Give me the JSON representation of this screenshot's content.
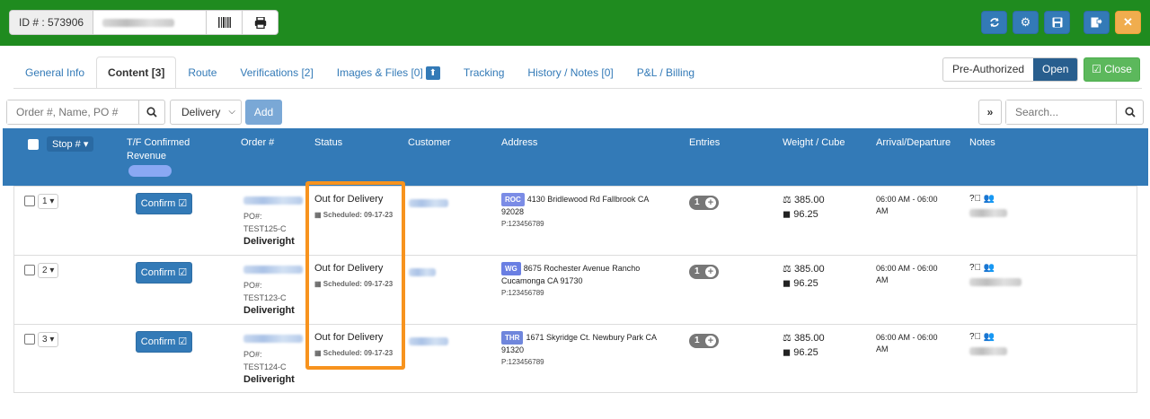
{
  "topbar": {
    "id_label": "ID # : 573906",
    "barcode_icon": "barcode-icon",
    "print_icon": "print-icon",
    "buttons": [
      "refresh-icon",
      "gear-icon",
      "save-icon",
      "save-exit-icon",
      "close-icon"
    ],
    "close_symbol": "✕"
  },
  "tabs": [
    {
      "label": "General Info"
    },
    {
      "label": "Content [3]"
    },
    {
      "label": "Route"
    },
    {
      "label": "Verifications [2]"
    },
    {
      "label": "Images & Files [0]"
    },
    {
      "label": "Tracking"
    },
    {
      "label": "History / Notes [0]"
    },
    {
      "label": "P&L / Billing"
    }
  ],
  "status_toggle": {
    "preauth": "Pre-Authorized",
    "open": "Open"
  },
  "close_btn": "Close",
  "search": {
    "placeholder": "Order #, Name, PO #",
    "delivery": "Delivery",
    "add": "Add",
    "right_placeholder": "Search..."
  },
  "table": {
    "headers": {
      "stop": "Stop #",
      "tf1": "T/F Confirmed",
      "tf2": "Revenue",
      "order": "Order #",
      "status": "Status",
      "customer": "Customer",
      "address": "Address",
      "entries": "Entries",
      "weight": "Weight / Cube",
      "arrival": "Arrival/Departure",
      "notes": "Notes"
    },
    "rows": [
      {
        "stop": "1",
        "confirm": "Confirm",
        "po": "PO#:",
        "po_value": "TEST125-C",
        "carrier": "Deliveright",
        "status": "Out for Delivery",
        "scheduled": "Scheduled: 09-17-23",
        "badge": "ROC",
        "badge_color": "#7b8ce6",
        "address": "4130 Bridlewood Rd Fallbrook CA 92028",
        "phone": "P:123456789",
        "entries": "1",
        "weight": "385.00",
        "cube": "96.25",
        "arrival": "06:00 AM - 06:00 AM"
      },
      {
        "stop": "2",
        "confirm": "Confirm",
        "po": "PO#:",
        "po_value": "TEST123-C",
        "carrier": "Deliveright",
        "status": "Out for Delivery",
        "scheduled": "Scheduled: 09-17-23",
        "badge": "WG",
        "badge_color": "#6a7fe3",
        "address": "8675 Rochester Avenue Rancho Cucamonga CA 91730",
        "phone": "P:123456789",
        "entries": "1",
        "weight": "385.00",
        "cube": "96.25",
        "arrival": "06:00 AM - 06:00 AM"
      },
      {
        "stop": "3",
        "confirm": "Confirm",
        "po": "PO#:",
        "po_value": "TEST124-C",
        "carrier": "Deliveright",
        "status": "Out for Delivery",
        "scheduled": "Scheduled: 09-17-23",
        "badge": "THR",
        "badge_color": "#6f86dc",
        "address": "1671 Skyridge Ct. Newbury Park CA 91320",
        "phone": "P:123456789",
        "entries": "1",
        "weight": "385.00",
        "cube": "96.25",
        "arrival": "06:00 AM - 06:00 AM"
      }
    ]
  },
  "highlight_color": "#f7931e"
}
